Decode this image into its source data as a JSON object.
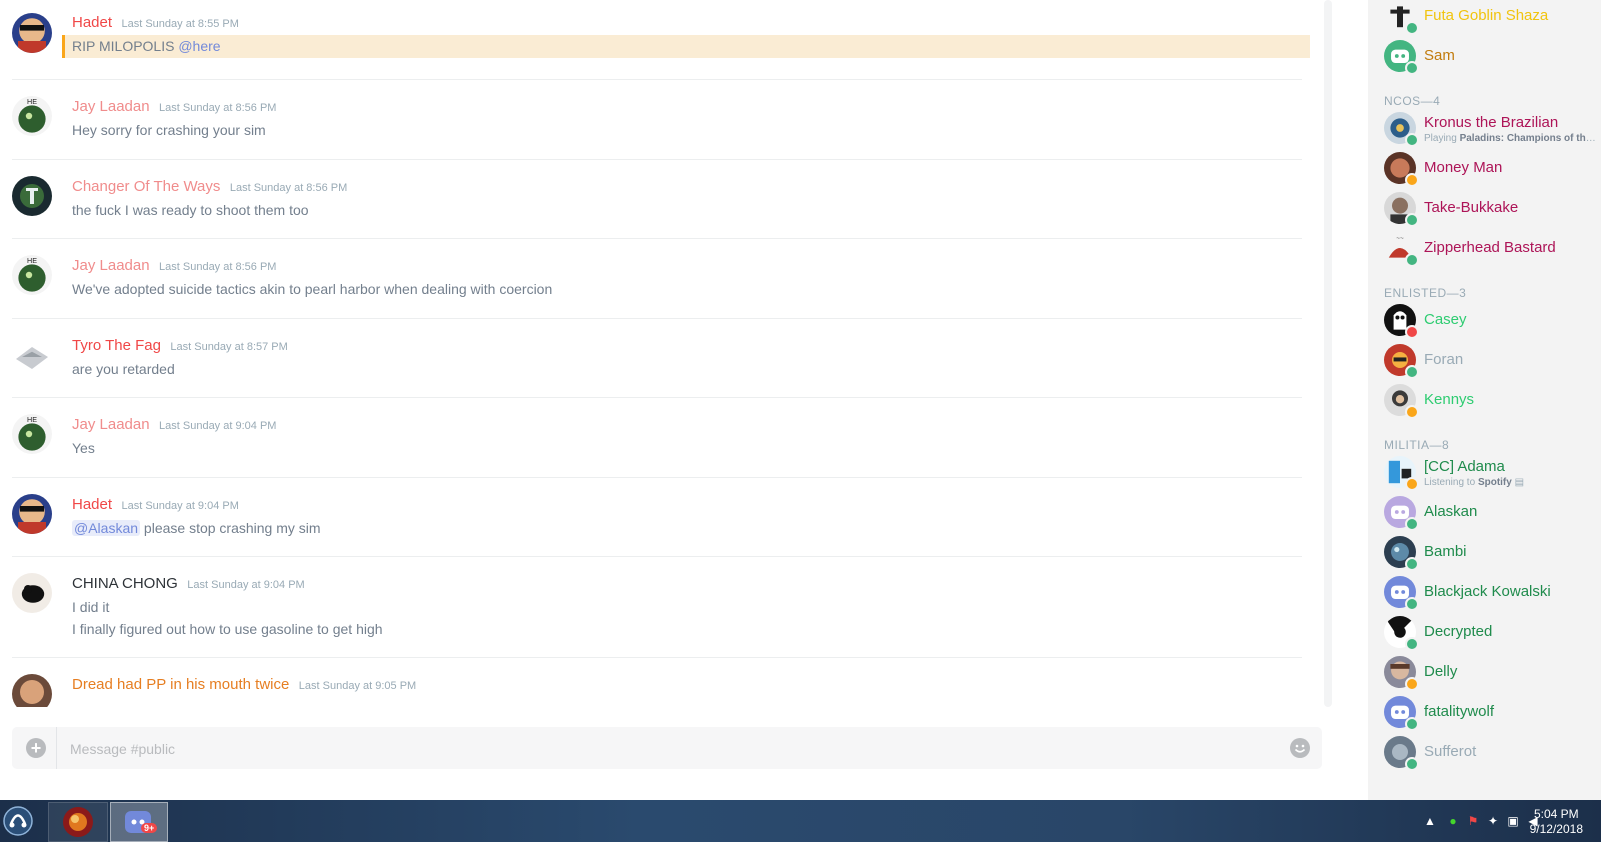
{
  "messages": [
    {
      "username": "Hadet",
      "color": "#f04747",
      "timestamp": "Last Sunday at 8:55 PM",
      "lines": [],
      "mention_line": {
        "text": "RIP MILOPOLIS",
        "mention": "@here"
      },
      "highlight": true,
      "avatar": "hadet"
    },
    {
      "username": "Jay Laadan",
      "color": "#f08c8c",
      "timestamp": "Last Sunday at 8:56 PM",
      "lines": [
        "Hey sorry for crashing your sim"
      ],
      "avatar": "jay"
    },
    {
      "username": "Changer Of The Ways",
      "color": "#f08c8c",
      "timestamp": "Last Sunday at 8:56 PM",
      "lines": [
        "the fuck I was ready to shoot them too"
      ],
      "avatar": "changer"
    },
    {
      "username": "Jay Laadan",
      "color": "#f08c8c",
      "timestamp": "Last Sunday at 8:56 PM",
      "lines": [
        "We've adopted suicide tactics akin to pearl harbor when dealing with coercion"
      ],
      "avatar": "jay"
    },
    {
      "username": "Tyro The Fag",
      "color": "#f04747",
      "timestamp": "Last Sunday at 8:57 PM",
      "lines": [
        "are you retarded"
      ],
      "avatar": "tyro"
    },
    {
      "username": "Jay Laadan",
      "color": "#f08c8c",
      "timestamp": "Last Sunday at 9:04 PM",
      "lines": [
        "Yes"
      ],
      "avatar": "jay"
    },
    {
      "username": "Hadet",
      "color": "#f04747",
      "timestamp": "Last Sunday at 9:04 PM",
      "lines": [],
      "pill_line": {
        "mention": "@Alaskan",
        "text": " please stop crashing my sim"
      },
      "avatar": "hadet"
    },
    {
      "username": "CHINA CHONG",
      "color": "#2e3338",
      "timestamp": "Last Sunday at 9:04 PM",
      "lines": [
        "I did it",
        "I finally figured out how to use gasoline to get high"
      ],
      "avatar": "china"
    },
    {
      "username": "Dread had PP in his mouth twice",
      "color": "#e67e22",
      "timestamp": "Last Sunday at 9:05 PM",
      "lines": [],
      "avatar": "dread"
    }
  ],
  "composer": {
    "placeholder": "Message #public"
  },
  "members": {
    "top": [
      {
        "name": "Futa Goblin Shaza",
        "color": "#f1c40f",
        "status": "online",
        "avatar": "futa"
      },
      {
        "name": "Sam",
        "color": "#c27c0e",
        "status": "online",
        "avatar": "discord-green"
      }
    ],
    "roles": [
      {
        "title": "NCOS—4",
        "members": [
          {
            "name": "Kronus the Brazilian",
            "color": "#ad1457",
            "status": "online",
            "activity_prefix": "Playing ",
            "activity": "Paladins: Champions of the Realm",
            "avatar": "kronus"
          },
          {
            "name": "Money Man",
            "color": "#ad1457",
            "status": "idle",
            "avatar": "money"
          },
          {
            "name": "Take-Bukkake",
            "color": "#ad1457",
            "status": "online",
            "avatar": "take"
          },
          {
            "name": "Zipperhead Bastard",
            "color": "#ad1457",
            "status": "online",
            "avatar": "zipper"
          }
        ]
      },
      {
        "title": "ENLISTED—3",
        "members": [
          {
            "name": "Casey",
            "color": "#2ecc71",
            "status": "dnd",
            "avatar": "casey"
          },
          {
            "name": "Foran",
            "color": "#99aab5",
            "status": "online",
            "avatar": "foran"
          },
          {
            "name": "Kennys",
            "color": "#2ecc71",
            "status": "idle",
            "avatar": "kennys"
          }
        ]
      },
      {
        "title": "MILITIA—8",
        "members": [
          {
            "name": "[CC] Adama",
            "color": "#1f8b4c",
            "status": "idle",
            "activity_prefix": "Listening to ",
            "activity": "Spotify",
            "avatar": "adama"
          },
          {
            "name": "Alaskan",
            "color": "#1f8b4c",
            "status": "online",
            "avatar": "alaskan"
          },
          {
            "name": "Bambi",
            "color": "#1f8b4c",
            "status": "online",
            "avatar": "bambi"
          },
          {
            "name": "Blackjack Kowalski",
            "color": "#1f8b4c",
            "status": "online",
            "avatar": "discord-blue"
          },
          {
            "name": "Decrypted",
            "color": "#1f8b4c",
            "status": "online",
            "avatar": "decrypted"
          },
          {
            "name": "Delly",
            "color": "#1f8b4c",
            "status": "idle",
            "avatar": "delly"
          },
          {
            "name": "fatalitywolf",
            "color": "#1f8b4c",
            "status": "online",
            "avatar": "discord-blue"
          },
          {
            "name": "Sufferot",
            "color": "#99aab5",
            "status": "online",
            "avatar": "sufferot"
          }
        ]
      }
    ]
  },
  "status_colors": {
    "online": "#43b581",
    "idle": "#faa61a",
    "dnd": "#f04747"
  },
  "taskbar": {
    "discord_badge": "9+",
    "clock_time": "5:04 PM",
    "clock_date": "9/12/2018"
  }
}
